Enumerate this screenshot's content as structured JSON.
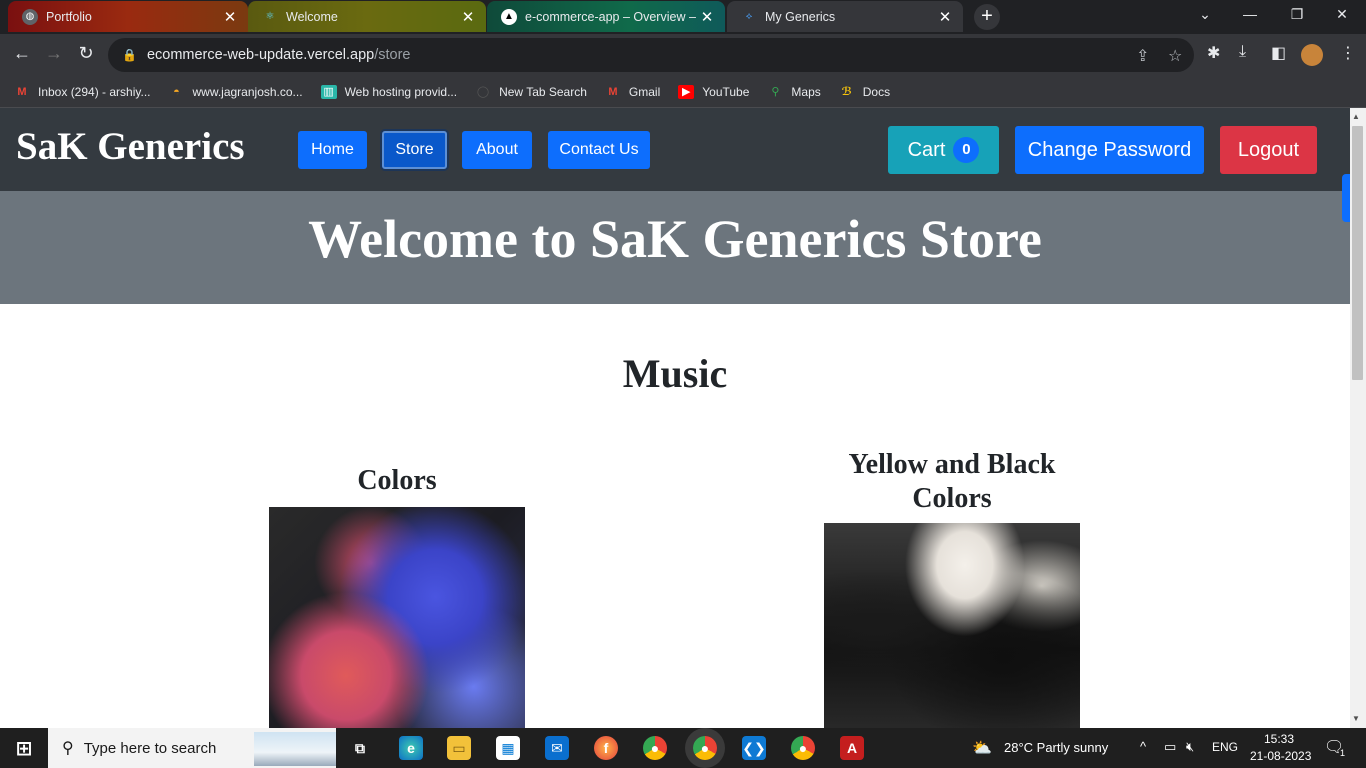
{
  "browser": {
    "tabs": [
      {
        "title": "Portfolio",
        "color": "#8b1a1a"
      },
      {
        "title": "Welcome",
        "color": "#4b4b10"
      },
      {
        "title": "e-commerce-app – Overview – Ve",
        "color": "#0f5a4a"
      },
      {
        "title": "My Generics",
        "color": "#35363a"
      }
    ],
    "url_host": "ecommerce-web-update.vercel.app",
    "url_path": "/store",
    "bookmarks": [
      "Inbox (294) - arshiy...",
      "www.jagranjosh.co...",
      "Web hosting provid...",
      "New Tab Search",
      "Gmail",
      "YouTube",
      "Maps",
      "Docs"
    ]
  },
  "site": {
    "brand": "SaK Generics",
    "nav": [
      "Home",
      "Store",
      "About",
      "Contact Us"
    ],
    "active_nav": "Store",
    "cart_label": "Cart",
    "cart_count": "0",
    "change_password": "Change Password",
    "logout": "Logout",
    "banner": "Welcome to SaK Generics Store",
    "section": "Music",
    "products": [
      {
        "title": "Colors"
      },
      {
        "title": "Yellow and Black Colors"
      }
    ],
    "colors": {
      "navbar": "#343a40",
      "primary": "#0d6efd",
      "info": "#17a2b8",
      "danger": "#dc3545",
      "banner": "#6c757d"
    }
  },
  "taskbar": {
    "search_placeholder": "Type here to search",
    "weather": "28°C  Partly sunny",
    "lang": "ENG",
    "time": "15:33",
    "date": "21-08-2023",
    "notifications": "1"
  }
}
